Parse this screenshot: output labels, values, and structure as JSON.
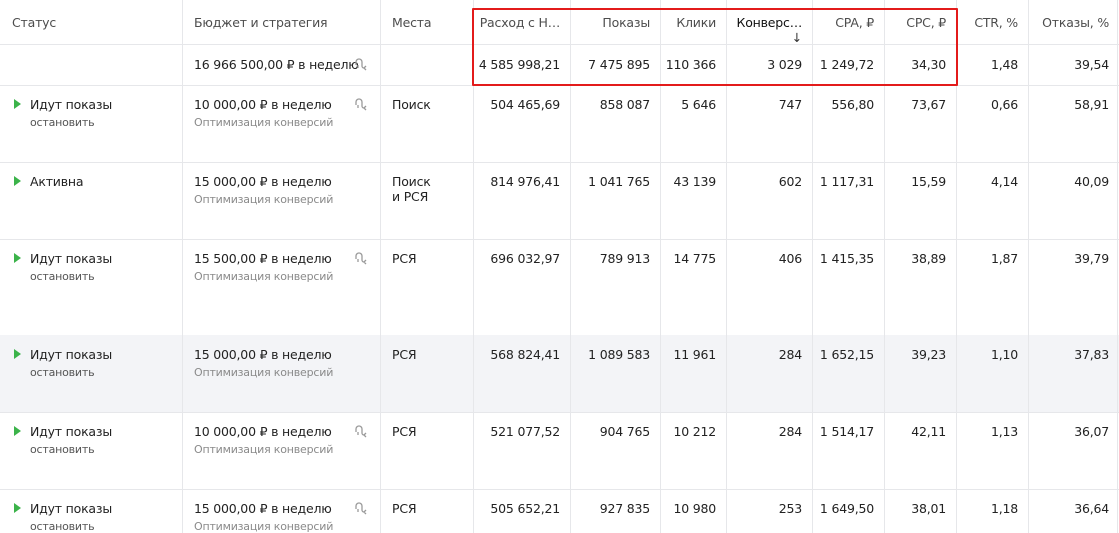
{
  "headers": {
    "status": "Статус",
    "budget": "Бюджет и стратегия",
    "places": "Места",
    "spend": "Расход с Н…",
    "impressions": "Показы",
    "clicks": "Клики",
    "conversions": "Конверс…",
    "sort_arrow": "↓",
    "cpa": "CPA, ₽",
    "cpc": "CPC, ₽",
    "ctr": "CTR, %",
    "bounces": "Отказы, %"
  },
  "totals": {
    "budget": "16 966 500,00 ₽ в неделю",
    "spend": "4 585 998,21",
    "impressions": "7 475 895",
    "clicks": "110 366",
    "conversions": "3 029",
    "cpa": "1 249,72",
    "cpc": "34,30",
    "ctr": "1,48",
    "bounces": "39,54"
  },
  "rows": [
    {
      "status": "Идут показы",
      "action": "остановить",
      "budget": "10 000,00 ₽ в неделю",
      "strategy": "Оптимизация конверсий",
      "places_line1": "Поиск",
      "places_line2": "",
      "spend": "504 465,69",
      "impressions": "858 087",
      "clicks": "5 646",
      "conversions": "747",
      "cpa": "556,80",
      "cpc": "73,67",
      "ctr": "0,66",
      "bounces": "58,91"
    },
    {
      "status": "Активна",
      "action": "",
      "budget": "15 000,00 ₽ в неделю",
      "strategy": "Оптимизация конверсий",
      "places_line1": "Поиск",
      "places_line2": "и РСЯ",
      "spend": "814 976,41",
      "impressions": "1 041 765",
      "clicks": "43 139",
      "conversions": "602",
      "cpa": "1 117,31",
      "cpc": "15,59",
      "ctr": "4,14",
      "bounces": "40,09"
    },
    {
      "status": "Идут показы",
      "action": "остановить",
      "budget": "15 500,00 ₽ в неделю",
      "strategy": "Оптимизация конверсий",
      "places_line1": "РСЯ",
      "places_line2": "",
      "spend": "696 032,97",
      "impressions": "789 913",
      "clicks": "14 775",
      "conversions": "406",
      "cpa": "1 415,35",
      "cpc": "38,89",
      "ctr": "1,87",
      "bounces": "39,79"
    },
    {
      "status": "Идут показы",
      "action": "остановить",
      "budget": "15 000,00 ₽ в неделю",
      "strategy": "Оптимизация конверсий",
      "places_line1": "РСЯ",
      "places_line2": "",
      "spend": "568 824,41",
      "impressions": "1 089 583",
      "clicks": "11 961",
      "conversions": "284",
      "cpa": "1 652,15",
      "cpc": "39,23",
      "ctr": "1,10",
      "bounces": "37,83"
    },
    {
      "status": "Идут показы",
      "action": "остановить",
      "budget": "10 000,00 ₽ в неделю",
      "strategy": "Оптимизация конверсий",
      "places_line1": "РСЯ",
      "places_line2": "",
      "spend": "521 077,52",
      "impressions": "904 765",
      "clicks": "10 212",
      "conversions": "284",
      "cpa": "1 514,17",
      "cpc": "42,11",
      "ctr": "1,13",
      "bounces": "36,07"
    },
    {
      "status": "Идут показы",
      "action": "остановить",
      "budget": "15 000,00 ₽ в неделю",
      "strategy": "Оптимизация конверсий",
      "places_line1": "РСЯ",
      "places_line2": "",
      "spend": "505 652,21",
      "impressions": "927 835",
      "clicks": "10 980",
      "conversions": "253",
      "cpa": "1 649,50",
      "cpc": "38,01",
      "ctr": "1,18",
      "bounces": "36,64"
    }
  ],
  "colors": {
    "status_active": "#3bb34a",
    "highlight_border": "#e31b1b",
    "row_highlight": "#f3f4f7"
  }
}
